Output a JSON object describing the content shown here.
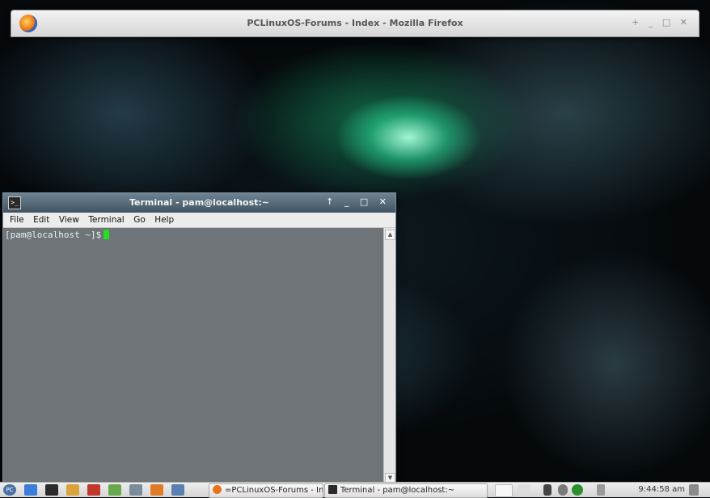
{
  "firefox_window": {
    "title": "PCLinuxOS-Forums - Index - Mozilla Firefox",
    "controls": "+ _ □ ✕"
  },
  "terminal_window": {
    "title": "Terminal - pam@localhost:~",
    "controls": "↑ _ □ ✕",
    "icon_glyph": ">_",
    "menu": [
      "File",
      "Edit",
      "View",
      "Terminal",
      "Go",
      "Help"
    ],
    "prompt": "[pam@localhost ~]$"
  },
  "taskbar": {
    "launchers": [
      {
        "name": "pclinuxos-menu-icon",
        "color": "#4a6fa5",
        "glyph": "PC"
      },
      {
        "name": "file-manager-icon",
        "color": "#3b7dd8"
      },
      {
        "name": "terminal-launcher-icon",
        "color": "#2b2b2b"
      },
      {
        "name": "text-editor-icon",
        "color": "#d9a23a"
      },
      {
        "name": "screenshot-icon",
        "color": "#c0392b"
      },
      {
        "name": "software-installer-icon",
        "color": "#6aa84f"
      },
      {
        "name": "control-center-icon",
        "color": "#7a8c99"
      },
      {
        "name": "web-browser-icon",
        "color": "#e07b27"
      },
      {
        "name": "show-desktop-icon",
        "color": "#5b7fb0"
      }
    ],
    "tasks": [
      {
        "label": "=PCLinuxOS-Forums - Ind...",
        "icon_color": "#e8731a"
      },
      {
        "label": "Terminal - pam@localhost:~",
        "icon_color": "#2a2a2a"
      }
    ],
    "clock": "9:44:58 am"
  }
}
